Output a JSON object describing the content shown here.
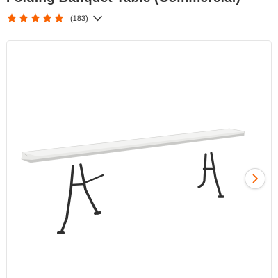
{
  "product": {
    "title": "Folding Banquet Table (Commercial)",
    "rating": 5,
    "review_count": "(183)"
  },
  "colors": {
    "accent": "#f96302",
    "text": "#333333",
    "border": "#e5e5e5"
  },
  "icons": {
    "rating": "star-icon",
    "expand": "chevron-down-icon",
    "next": "chevron-right-icon"
  }
}
